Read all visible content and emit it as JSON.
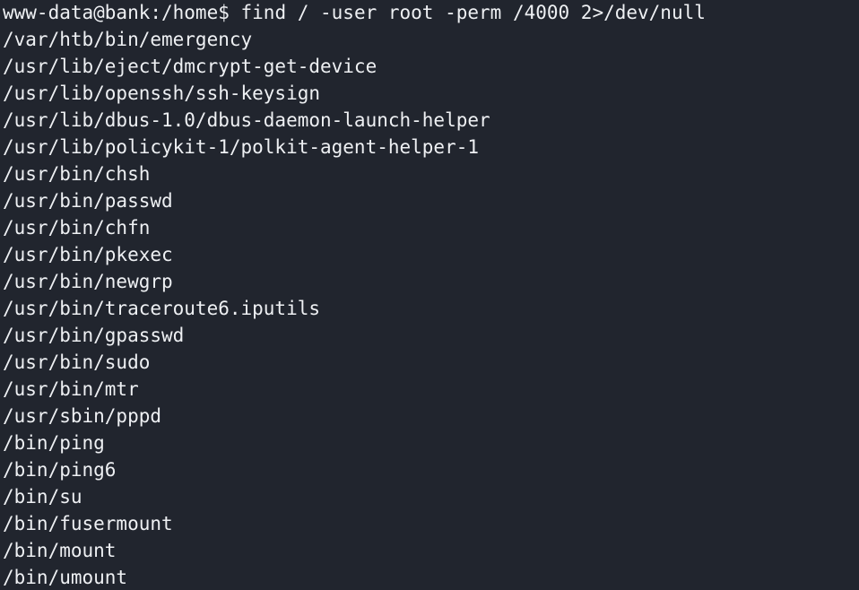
{
  "terminal": {
    "prompt": "www-data@bank:/home$ ",
    "command": "find / -user root -perm /4000 2>/dev/null",
    "output": [
      "/var/htb/bin/emergency",
      "/usr/lib/eject/dmcrypt-get-device",
      "/usr/lib/openssh/ssh-keysign",
      "/usr/lib/dbus-1.0/dbus-daemon-launch-helper",
      "/usr/lib/policykit-1/polkit-agent-helper-1",
      "/usr/bin/chsh",
      "/usr/bin/passwd",
      "/usr/bin/chfn",
      "/usr/bin/pkexec",
      "/usr/bin/newgrp",
      "/usr/bin/traceroute6.iputils",
      "/usr/bin/gpasswd",
      "/usr/bin/sudo",
      "/usr/bin/mtr",
      "/usr/sbin/pppd",
      "/bin/ping",
      "/bin/ping6",
      "/bin/su",
      "/bin/fusermount",
      "/bin/mount",
      "/bin/umount"
    ]
  },
  "colors": {
    "background": "#21252e",
    "foreground": "#eef0f3"
  }
}
